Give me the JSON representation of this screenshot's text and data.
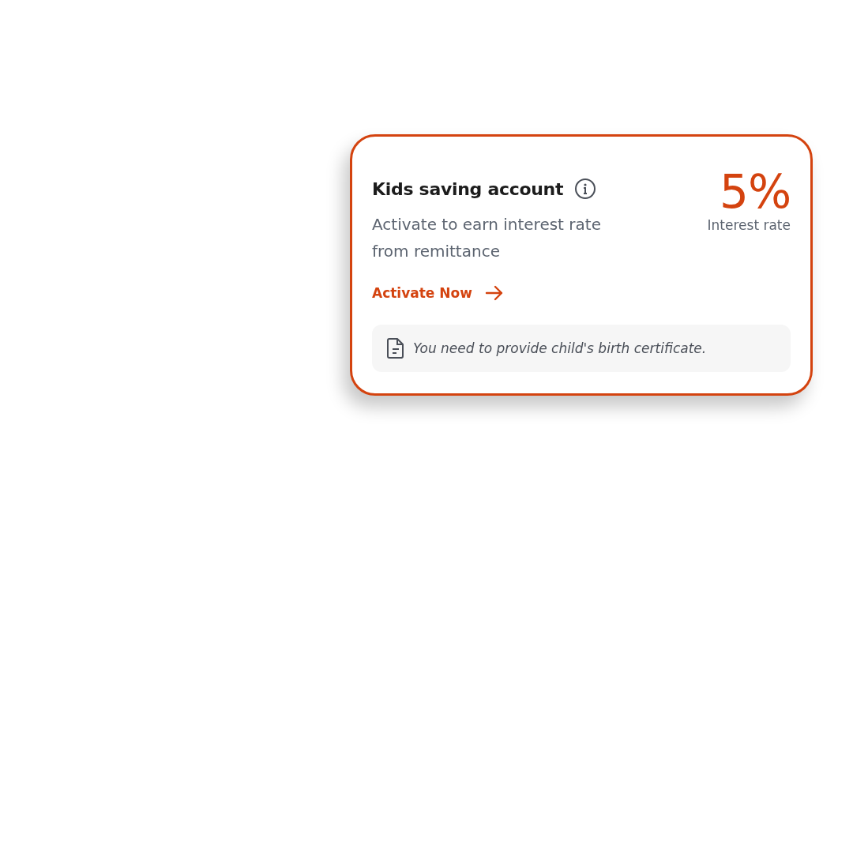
{
  "card": {
    "title": "Kids saving account",
    "description": "Activate to earn interest rate from remittance",
    "rate": "5%",
    "rate_label": "Interest rate",
    "action": "Activate Now",
    "note": "You need to provide child's birth certificate."
  }
}
